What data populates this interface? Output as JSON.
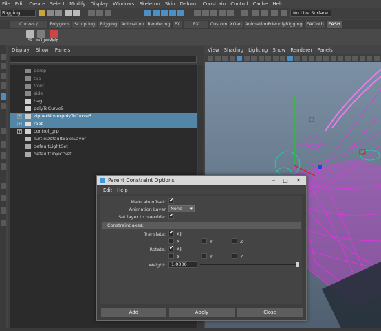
{
  "menubar": {
    "items": [
      "File",
      "Edit",
      "Create",
      "Select",
      "Modify",
      "Display",
      "Windows",
      "Skeleton",
      "Skin",
      "Deform",
      "Constrain",
      "Control",
      "Cache",
      "Help"
    ]
  },
  "statusline": {
    "mode": "Rigging",
    "live_surface": "No Live Surface"
  },
  "shelf_tabs": [
    "Curves / Surfaces",
    "Polygons",
    "Sculpting",
    "Rigging",
    "Animation",
    "Rendering",
    "FX",
    "FX Caching",
    "Custom",
    "XGen",
    "AnimationFriendlyRigging",
    "EACloth",
    "EASH"
  ],
  "shelf_buttons": [
    "SP",
    "ea3_pw",
    "Mjelp"
  ],
  "outliner": {
    "menu": [
      "Display",
      "Show",
      "Panels"
    ],
    "items": [
      {
        "label": "persp",
        "dim": true,
        "icon": "camera-icon",
        "expand": ""
      },
      {
        "label": "top",
        "dim": true,
        "icon": "camera-icon",
        "expand": ""
      },
      {
        "label": "front",
        "dim": true,
        "icon": "camera-icon",
        "expand": ""
      },
      {
        "label": "side",
        "dim": true,
        "icon": "camera-icon",
        "expand": ""
      },
      {
        "label": "bag",
        "dim": false,
        "icon": "mesh-icon",
        "expand": ""
      },
      {
        "label": "polyToCurve5",
        "dim": false,
        "icon": "curve-icon",
        "expand": ""
      },
      {
        "label": "zipperMoverpolyToCurve5",
        "dim": false,
        "icon": "curve-icon",
        "expand": "+",
        "selected": true
      },
      {
        "label": "root",
        "dim": false,
        "icon": "joint-icon",
        "expand": "+",
        "selected": true
      },
      {
        "label": "control_grp",
        "dim": false,
        "icon": "group-icon",
        "expand": "+"
      },
      {
        "label": "TurtleDefaultBakeLayer",
        "dim": false,
        "icon": "node-icon",
        "expand": ""
      },
      {
        "label": "defaultLightSet",
        "dim": false,
        "icon": "set-icon",
        "expand": ""
      },
      {
        "label": "defaultObjectSet",
        "dim": false,
        "icon": "set-icon",
        "expand": ""
      }
    ]
  },
  "viewport": {
    "menu": [
      "View",
      "Shading",
      "Lighting",
      "Show",
      "Renderer",
      "Panels"
    ]
  },
  "dialog": {
    "title": "Parent Constraint Options",
    "menu": [
      "Edit",
      "Help"
    ],
    "maintain_offset_label": "Maintain offset:",
    "maintain_offset": true,
    "animation_layer_label": "Animation Layer",
    "animation_layer_value": "None",
    "set_layer_override_label": "Set layer to override:",
    "set_layer_override": true,
    "constraint_axes_header": "Constraint axes:",
    "translate_label": "Translate:",
    "rotate_label": "Rotate:",
    "all_label": "All",
    "x_label": "X",
    "y_label": "Y",
    "z_label": "Z",
    "translate_all": true,
    "rotate_all": true,
    "weight_label": "Weight:",
    "weight_value": "1.0000",
    "buttons": {
      "add": "Add",
      "apply": "Apply",
      "close": "Close"
    }
  },
  "colors": {
    "selection": "#5285a6",
    "wireframe": "#e633e6",
    "axis_y": "#22cc22",
    "axis_x": "#cc2222",
    "axis_z": "#2244dd",
    "manipulator": "#22d8b0"
  }
}
